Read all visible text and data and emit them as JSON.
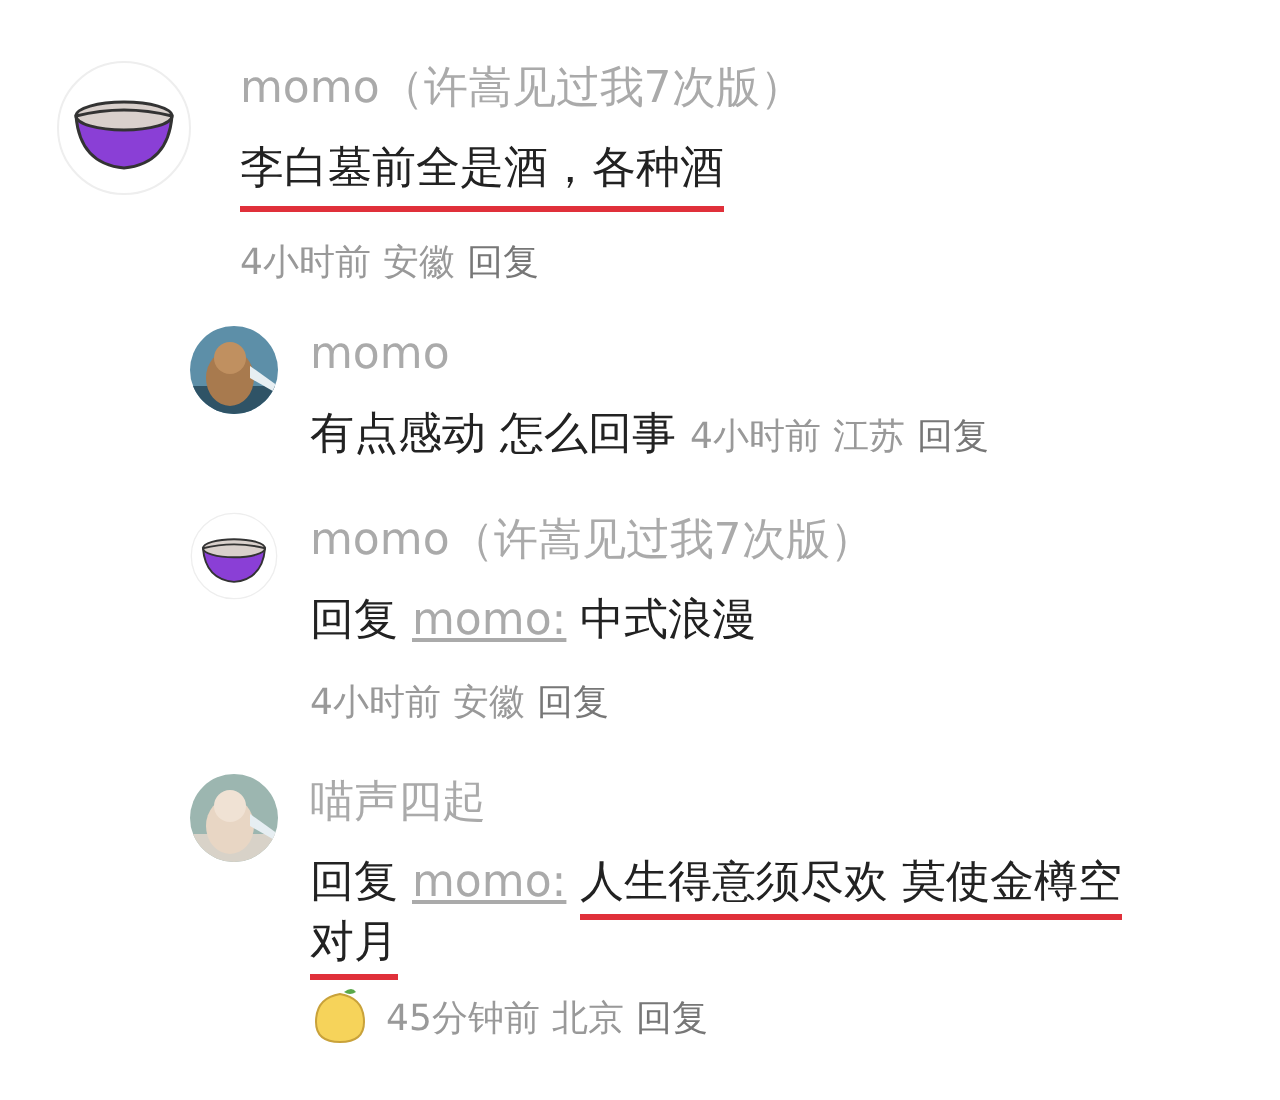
{
  "comment": {
    "avatar": {
      "kind": "bowl"
    },
    "author": "momo（许嵩见过我7次版）",
    "body": "李白墓前全是酒，各种酒",
    "highlighted": true,
    "time": "4小时前",
    "location": "安徽",
    "reply_action": "回复",
    "replies": [
      {
        "author": "momo",
        "body": "有点感动 怎么回事",
        "highlighted": false,
        "kind": "inline",
        "time": "4小时前",
        "location": "江苏",
        "reply_action": "回复"
      },
      {
        "avatar": {
          "kind": "bowl"
        },
        "author": "momo（许嵩见过我7次版）",
        "reply_prefix": "回复",
        "reply_to": "momo:",
        "body": "中式浪漫",
        "highlighted": false,
        "kind": "block",
        "time": "4小时前",
        "location": "安徽",
        "reply_action": "回复"
      },
      {
        "author": "喵声四起",
        "reply_prefix": "回复",
        "reply_to": "momo:",
        "body": "人生得意须尽欢 莫使金樽空对月",
        "highlighted": true,
        "emoji": true,
        "kind": "block",
        "time": "45分钟前",
        "location": "北京",
        "reply_action": "回复"
      }
    ]
  }
}
